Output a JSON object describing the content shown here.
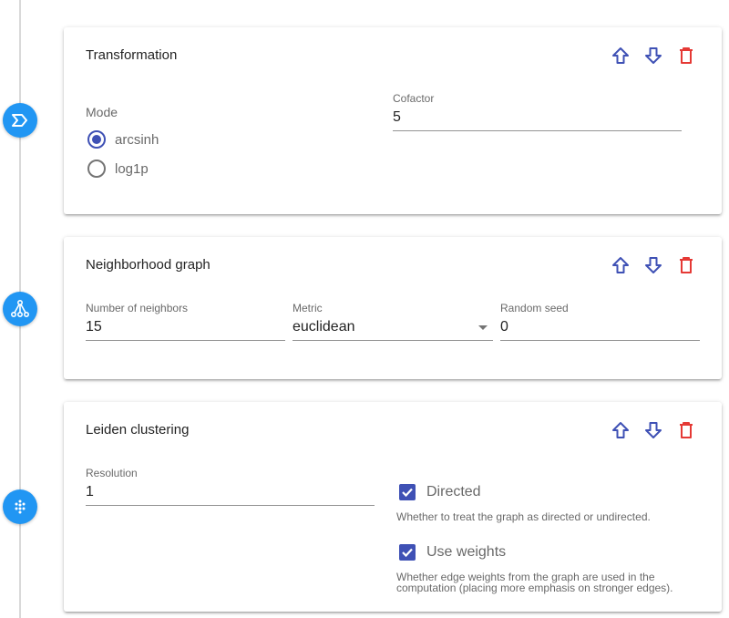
{
  "colors": {
    "accent": "#3f51b5",
    "step_icon": "#2196f3",
    "delete": "#e53935"
  },
  "steps": [
    {
      "icon": "sigma-icon"
    },
    {
      "icon": "graph-icon"
    },
    {
      "icon": "cluster-dots-icon"
    }
  ],
  "transformation": {
    "title": "Transformation",
    "mode_label": "Mode",
    "options": [
      "arcsinh",
      "log1p"
    ],
    "selected": "arcsinh",
    "cofactor_label": "Cofactor",
    "cofactor_value": "5"
  },
  "neighborhood": {
    "title": "Neighborhood graph",
    "neighbors_label": "Number of neighbors",
    "neighbors_value": "15",
    "metric_label": "Metric",
    "metric_value": "euclidean",
    "seed_label": "Random seed",
    "seed_value": "0"
  },
  "leiden": {
    "title": "Leiden clustering",
    "resolution_label": "Resolution",
    "resolution_value": "1",
    "directed_label": "Directed",
    "directed_checked": true,
    "directed_hint": "Whether to treat the graph as directed or undirected.",
    "weights_label": "Use weights",
    "weights_checked": true,
    "weights_hint": "Whether edge weights from the graph are used in the computation (placing more emphasis on stronger edges)."
  }
}
